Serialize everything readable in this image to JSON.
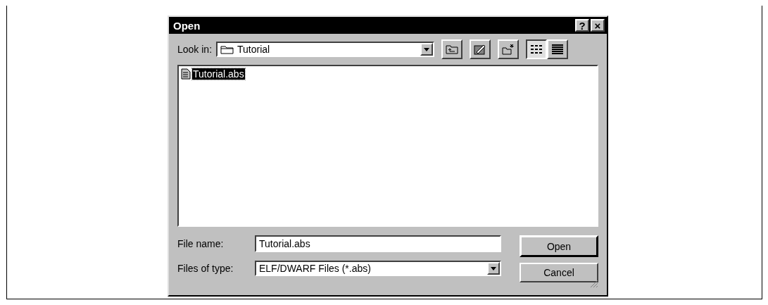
{
  "window": {
    "title": "Open",
    "help_button": "?",
    "close_button": "×"
  },
  "look_in": {
    "label": "Look in:",
    "value": "Tutorial"
  },
  "views": [
    {
      "kind": "list",
      "selected": true
    },
    {
      "kind": "details",
      "selected": false
    }
  ],
  "files": [
    {
      "name": "Tutorial.abs",
      "selected": true
    }
  ],
  "file_name": {
    "label": "File name:",
    "value": "Tutorial.abs"
  },
  "files_of_type": {
    "label": "Files of type:",
    "value": "ELF/DWARF Files (*.abs)"
  },
  "buttons": [
    {
      "label": "Open",
      "default": true
    },
    {
      "label": "Cancel",
      "default": false
    }
  ]
}
